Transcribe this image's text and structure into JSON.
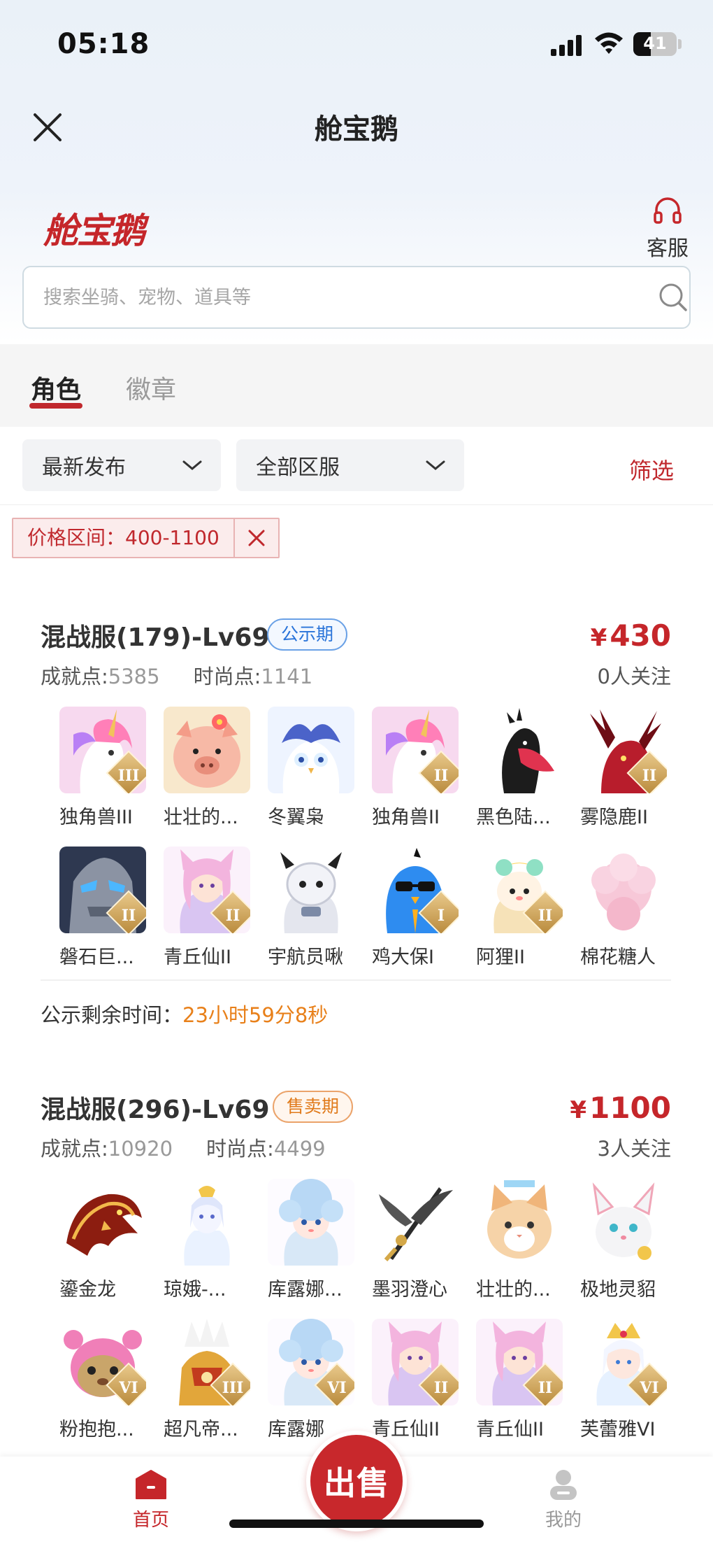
{
  "status_bar": {
    "time": "05:18",
    "battery": "41",
    "battery_level": 0.41
  },
  "nav": {
    "title": "舱宝鹅"
  },
  "header": {
    "logo": "舱宝鹅",
    "service_label": "客服"
  },
  "search": {
    "placeholder": "搜索坐骑、宠物、道具等"
  },
  "tabs": [
    {
      "label": "角色",
      "active": true
    },
    {
      "label": "徽章",
      "active": false
    }
  ],
  "filters": {
    "sort": "最新发布",
    "server": "全部区服",
    "filter_link": "筛选"
  },
  "active_filter": {
    "label": "价格区间：400-1100"
  },
  "listings": [
    {
      "title": "混战服(179)-Lv69",
      "badge": "公示期",
      "currency": "¥",
      "price": "430",
      "achievement_label": "成就点:",
      "achievement": "5385",
      "fashion_label": "时尚点:",
      "fashion": "1141",
      "follow": "0人关注",
      "items": [
        {
          "name": "独角兽III",
          "rank": "III",
          "icon": "unicorn"
        },
        {
          "name": "壮壮的...",
          "rank": "",
          "icon": "pig"
        },
        {
          "name": "冬翼枭",
          "rank": "",
          "icon": "owl"
        },
        {
          "name": "独角兽II",
          "rank": "II",
          "icon": "unicorn"
        },
        {
          "name": "黑色陆...",
          "rank": "",
          "icon": "black-bird"
        },
        {
          "name": "雾隐鹿II",
          "rank": "II",
          "icon": "deer"
        },
        {
          "name": "磐石巨...",
          "rank": "II",
          "icon": "stone-giant"
        },
        {
          "name": "青丘仙II",
          "rank": "II",
          "icon": "fox-fairy"
        },
        {
          "name": "宇航员啾",
          "rank": "",
          "icon": "astronaut"
        },
        {
          "name": "鸡大保I",
          "rank": "I",
          "icon": "blue-chick"
        },
        {
          "name": "阿狸II",
          "rank": "II",
          "icon": "ahri"
        },
        {
          "name": "棉花糖人",
          "rank": "",
          "icon": "cotton-candy"
        }
      ],
      "notice_label": "公示剩余时间：",
      "countdown": "23小时59分8秒"
    },
    {
      "title": "混战服(296)-Lv69",
      "badge": "售卖期",
      "currency": "¥",
      "price": "1100",
      "achievement_label": "成就点:",
      "achievement": "10920",
      "fashion_label": "时尚点:",
      "fashion": "4499",
      "follow": "3人关注",
      "items": [
        {
          "name": "鎏金龙",
          "rank": "",
          "icon": "dragon"
        },
        {
          "name": "琼娥-...",
          "rank": "",
          "icon": "moon-fairy"
        },
        {
          "name": "库露娜...",
          "rank": "",
          "icon": "kuluna"
        },
        {
          "name": "墨羽澄心",
          "rank": "",
          "icon": "feather-sword"
        },
        {
          "name": "壮壮的...",
          "rank": "",
          "icon": "cat"
        },
        {
          "name": "极地灵貂",
          "rank": "",
          "icon": "arctic-ferret"
        },
        {
          "name": "粉抱抱...",
          "rank": "VI",
          "icon": "pink-bear"
        },
        {
          "name": "超凡帝...",
          "rank": "III",
          "icon": "golden-armor"
        },
        {
          "name": "库露娜",
          "rank": "VI",
          "icon": "kuluna"
        },
        {
          "name": "青丘仙II",
          "rank": "II",
          "icon": "fox-fairy"
        },
        {
          "name": "青丘仙II",
          "rank": "II",
          "icon": "fox-fairy"
        },
        {
          "name": "芙蕾雅VI",
          "rank": "VI",
          "icon": "freya"
        }
      ]
    }
  ],
  "bottom_nav": {
    "home": "首页",
    "sell": "出售",
    "mine": "我的"
  },
  "colors": {
    "brand_red": "#c5262a",
    "countdown_orange": "#e8801a",
    "badge_blue": "#2a74d9"
  }
}
